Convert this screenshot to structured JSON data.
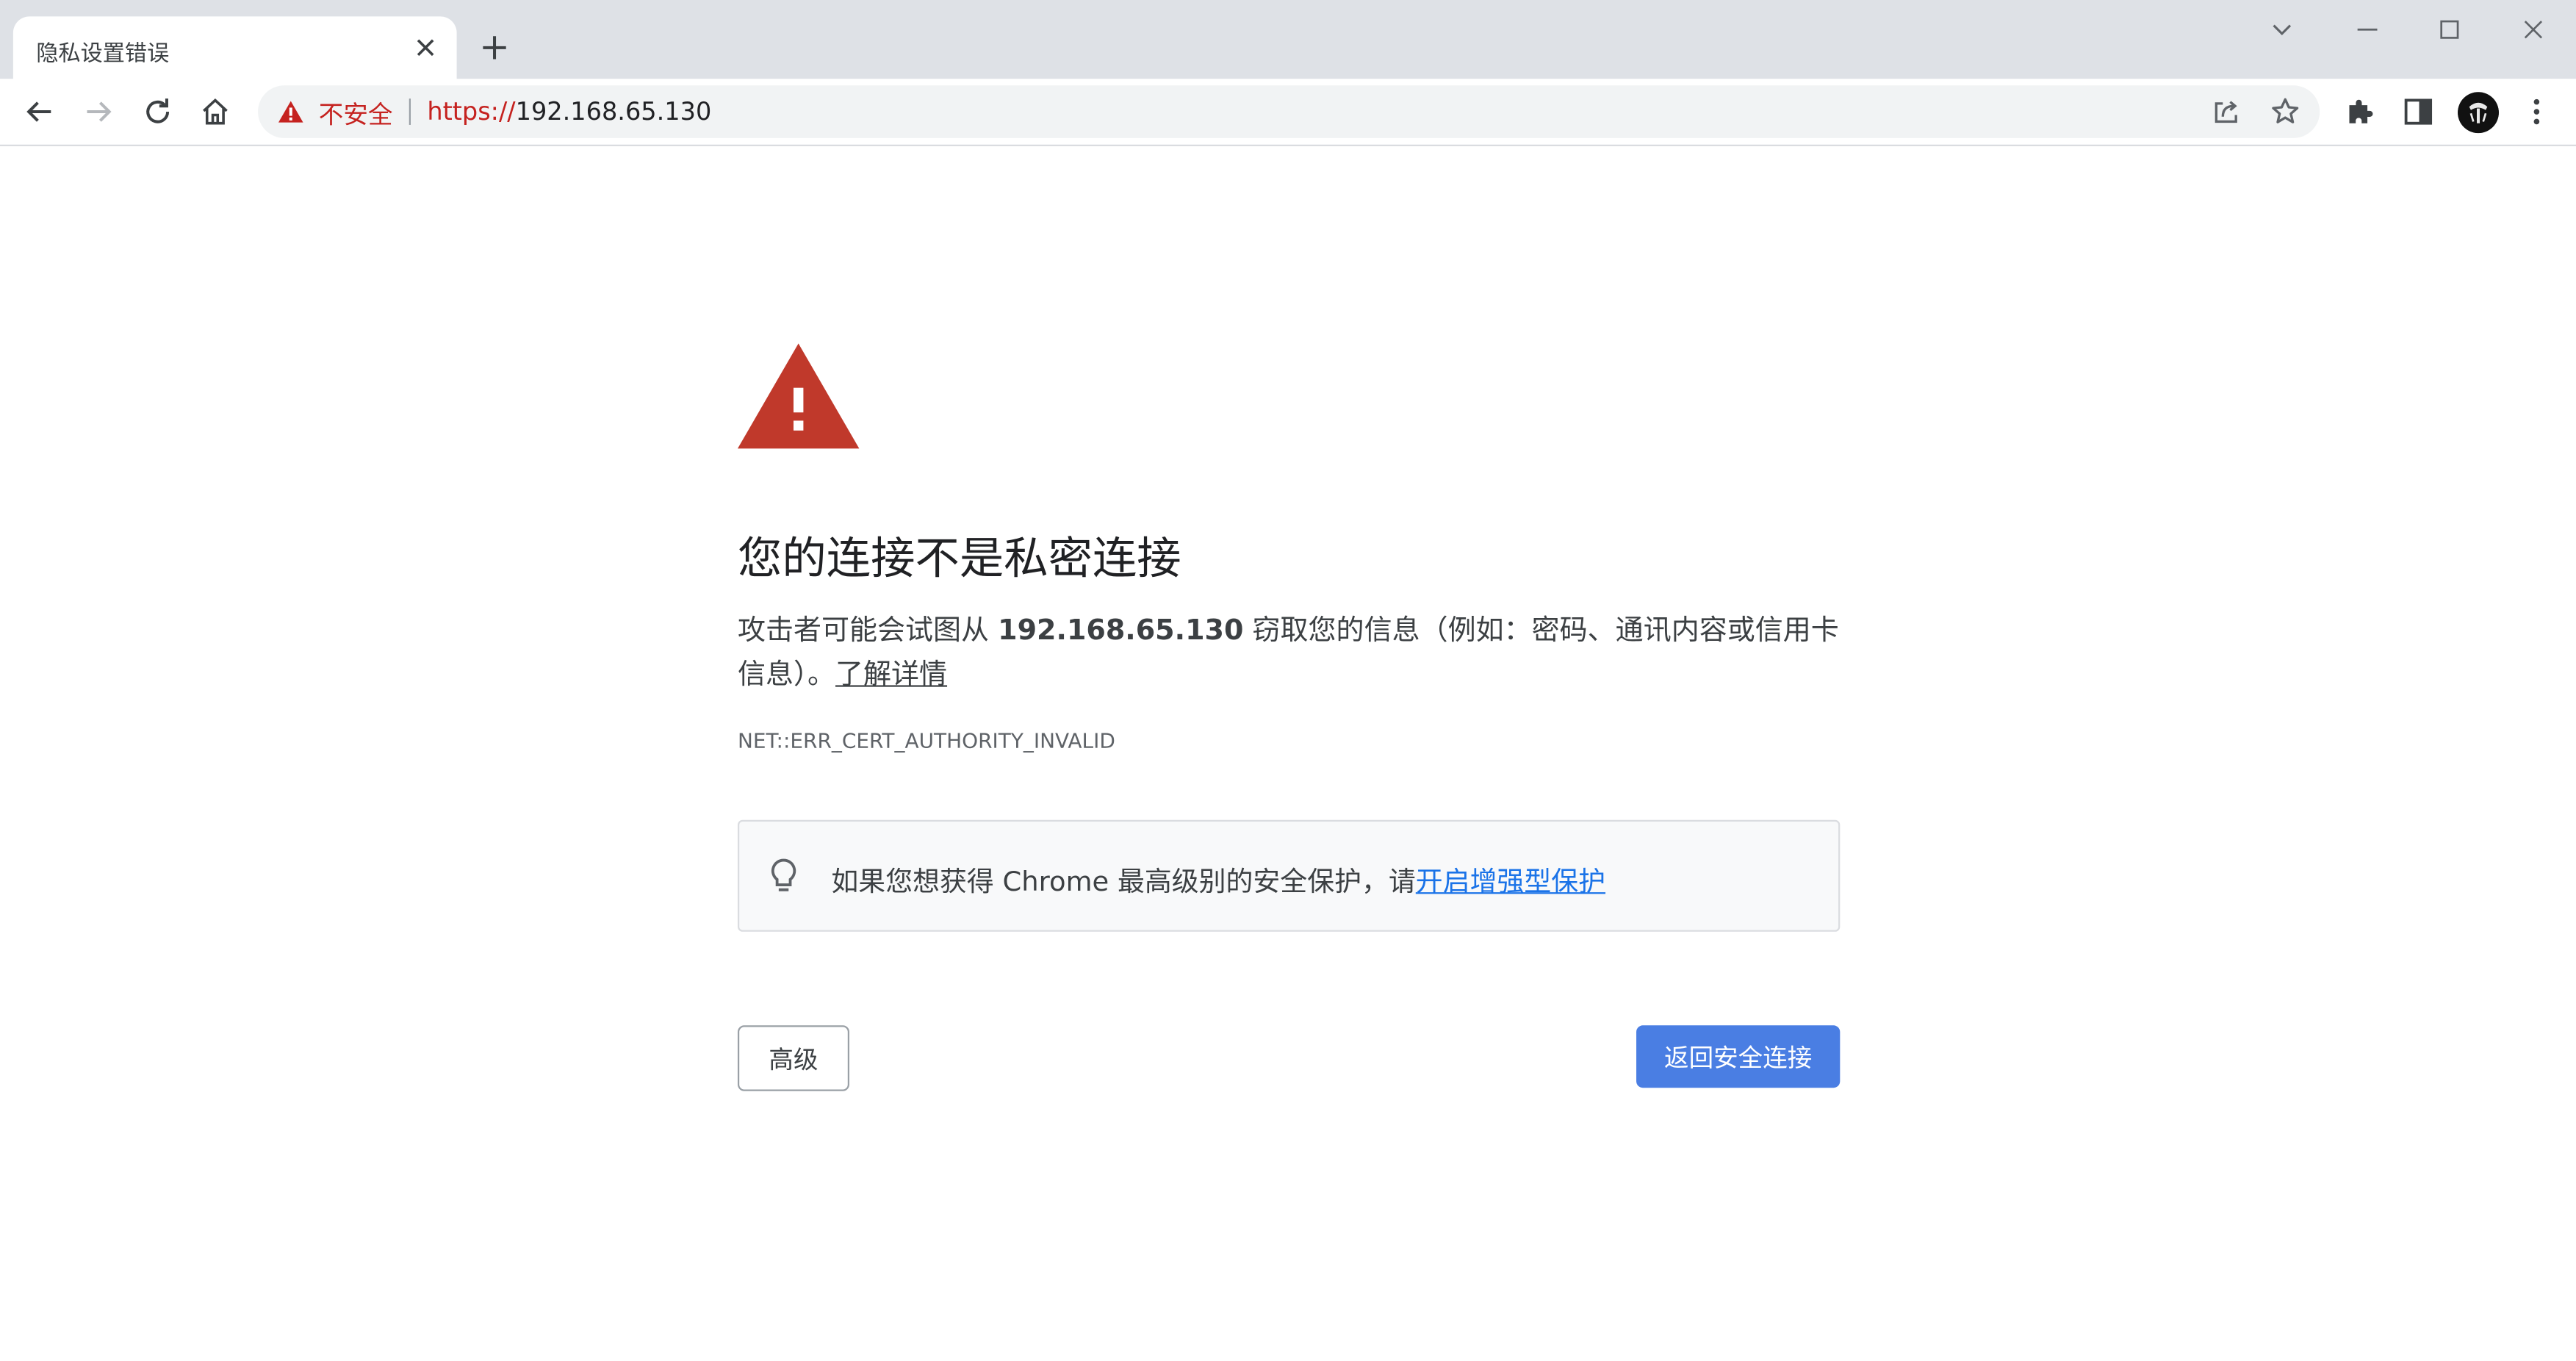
{
  "tab": {
    "title": "隐私设置错误"
  },
  "omnibox": {
    "security_label": "不安全",
    "url_scheme": "https://",
    "url_host": "192.168.65.130"
  },
  "page": {
    "heading": "您的连接不是私密连接",
    "desc_before": "攻击者可能会试图从 ",
    "desc_host": "192.168.65.130",
    "desc_after": " 窃取您的信息（例如：密码、通讯内容或信用卡信息）。",
    "learn_more": "了解详情",
    "error_code": "NET::ERR_CERT_AUTHORITY_INVALID",
    "tip_text": "如果您想获得 Chrome 最高级别的安全保护，请",
    "tip_link": "开启增强型保护",
    "advanced_button": "高级",
    "back_button": "返回安全连接"
  },
  "colors": {
    "danger": "#c5221f",
    "warning_triangle": "#c0392b",
    "primary_button": "#4a7ee3",
    "link": "#1a73e8"
  }
}
